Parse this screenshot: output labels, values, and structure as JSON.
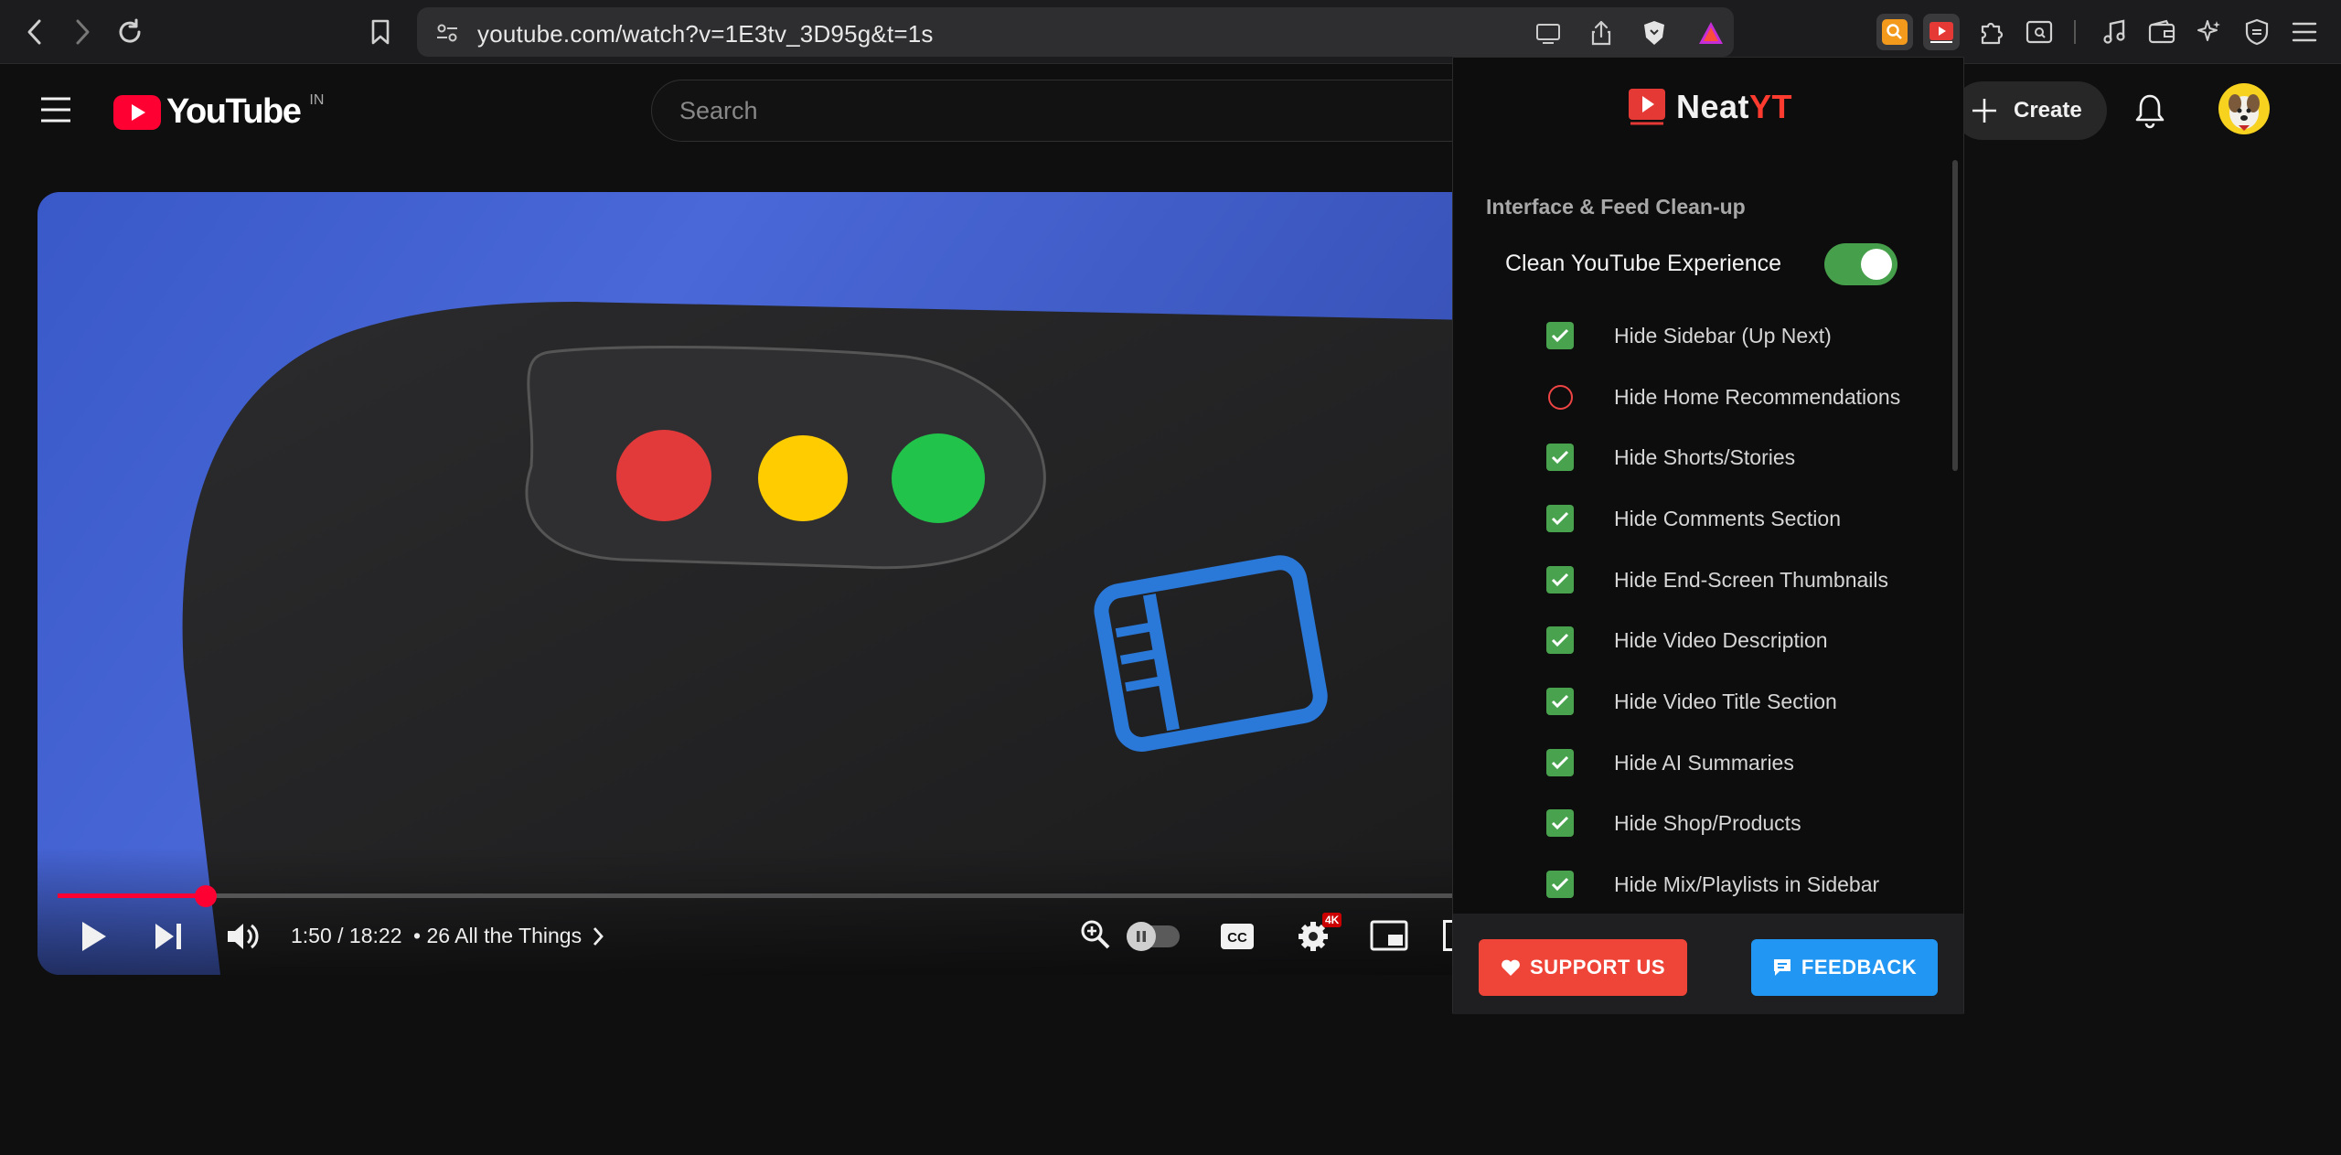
{
  "browser": {
    "url": "youtube.com/watch?v=1E3tv_3D95g&t=1s"
  },
  "youtube": {
    "logo_text": "YouTube",
    "region": "IN",
    "search_placeholder": "Search",
    "create_label": "Create"
  },
  "player": {
    "time": "1:50 / 18:22",
    "chapter": "• 26 All the Things",
    "progress_fraction": 0.1,
    "quality_badge": "4K"
  },
  "popup": {
    "logo_neat": "Neat",
    "logo_yt": "YT",
    "section_title": "Interface & Feed Clean-up",
    "master_label": "Clean YouTube Experience",
    "master_on": true,
    "options": [
      {
        "label": "Hide Sidebar (Up Next)",
        "checked": true
      },
      {
        "label": "Hide Home Recommendations",
        "checked": false
      },
      {
        "label": "Hide Shorts/Stories",
        "checked": true
      },
      {
        "label": "Hide Comments Section",
        "checked": true
      },
      {
        "label": "Hide End-Screen Thumbnails",
        "checked": true
      },
      {
        "label": "Hide Video Description",
        "checked": true
      },
      {
        "label": "Hide Video Title Section",
        "checked": true
      },
      {
        "label": "Hide AI Summaries",
        "checked": true
      },
      {
        "label": "Hide Shop/Products",
        "checked": true
      },
      {
        "label": "Hide Mix/Playlists in Sidebar",
        "checked": true
      }
    ],
    "support_label": "SUPPORT US",
    "feedback_label": "FEEDBACK"
  },
  "colors": {
    "youtube_red": "#ff0033",
    "toggle_green": "#46a04b",
    "support_red": "#ef4438",
    "feedback_blue": "#2196f3"
  }
}
